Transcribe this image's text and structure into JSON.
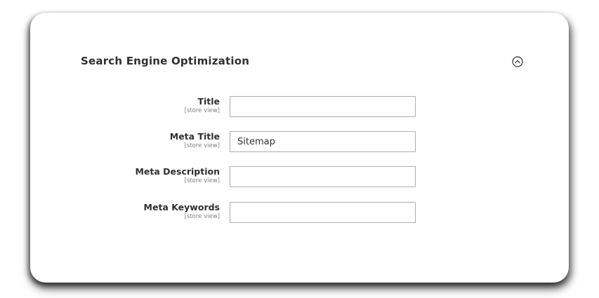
{
  "section": {
    "title": "Search Engine Optimization",
    "toggle_icon": "chevron-up-circle-icon"
  },
  "fields": [
    {
      "label": "Title",
      "scope": "[store view]",
      "value": ""
    },
    {
      "label": "Meta Title",
      "scope": "[store view]",
      "value": "Sitemap"
    },
    {
      "label": "Meta Description",
      "scope": "[store view]",
      "value": ""
    },
    {
      "label": "Meta Keywords",
      "scope": "[store view]",
      "value": ""
    }
  ],
  "colors": {
    "text": "#303030",
    "scope_text": "#808080",
    "input_border": "#adadad"
  }
}
